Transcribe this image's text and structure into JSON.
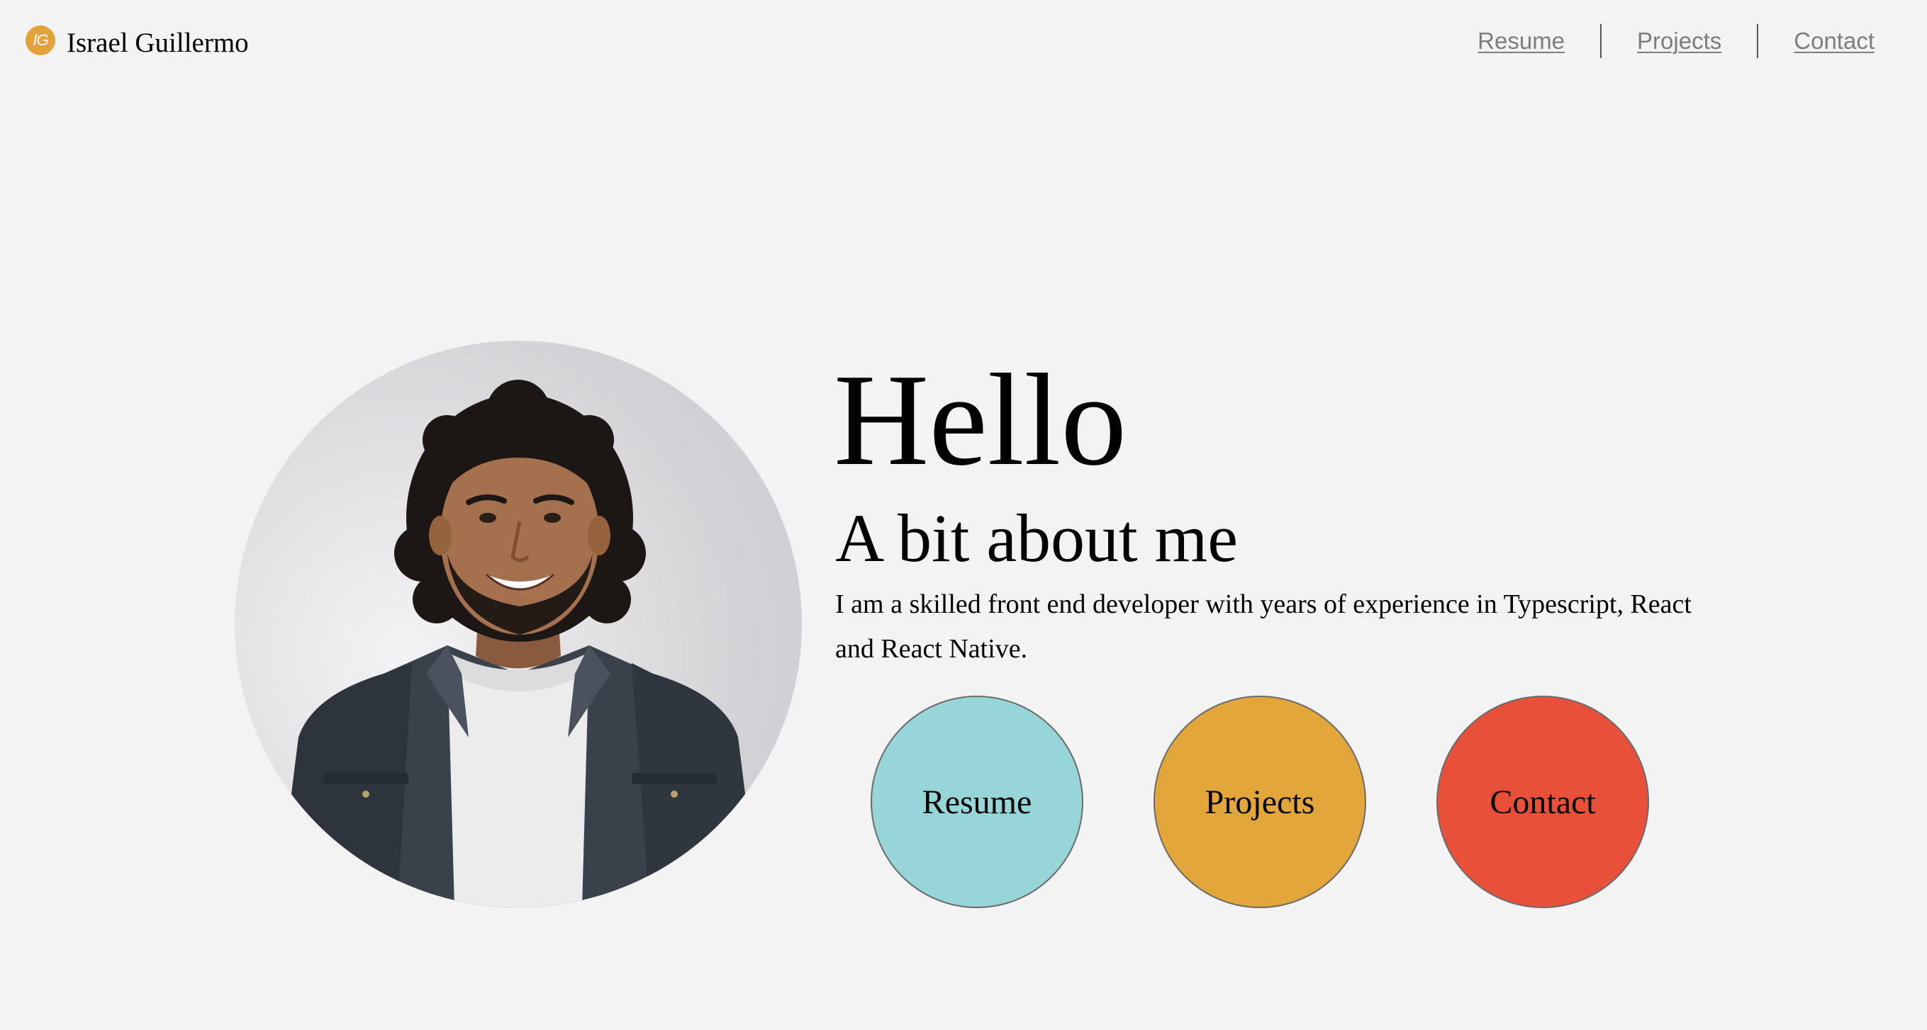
{
  "header": {
    "logo_text": "IG",
    "brand_name": "Israel Guillermo",
    "nav": [
      {
        "label": "Resume"
      },
      {
        "label": "Projects"
      },
      {
        "label": "Contact"
      }
    ]
  },
  "hero": {
    "greeting": "Hello",
    "subtitle": "A bit about me",
    "bio": "I am a skilled front end developer with years of experience in Typescript, React and React Native.",
    "buttons": [
      {
        "label": "Resume",
        "color": "#96d6d8"
      },
      {
        "label": "Projects",
        "color": "#e2a63a"
      },
      {
        "label": "Contact",
        "color": "#e9503a"
      }
    ]
  },
  "colors": {
    "background": "#f3f3f3",
    "logo": "#e2a43a",
    "nav_link": "#7d7d7d"
  }
}
